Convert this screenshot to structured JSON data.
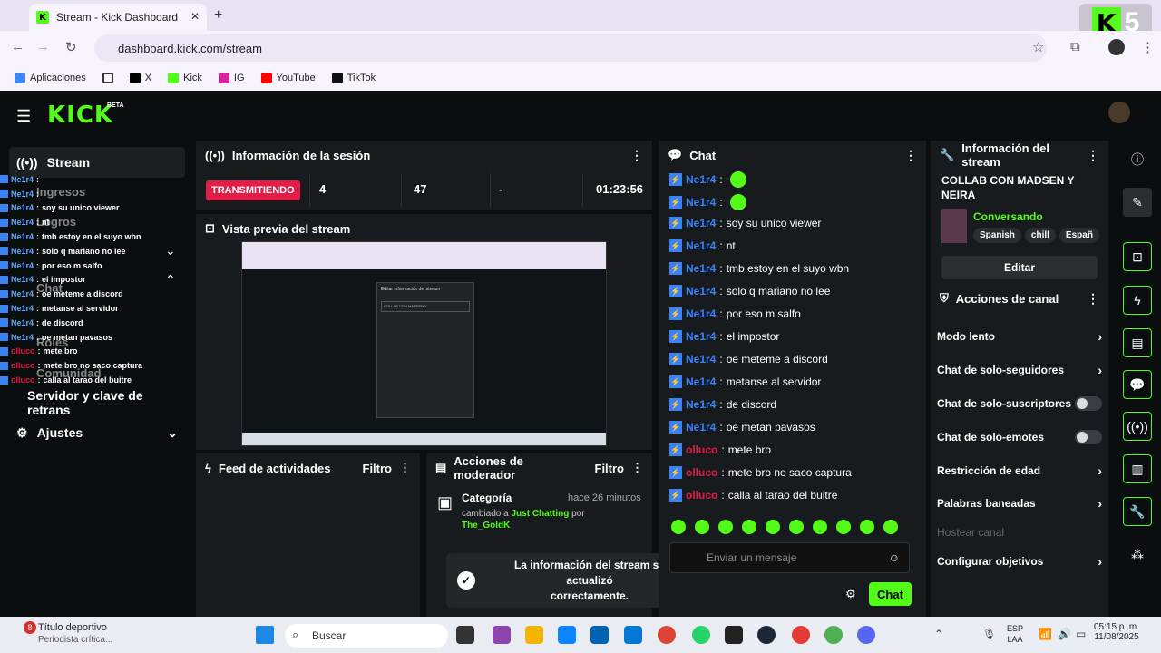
{
  "browser": {
    "tab_title": "Stream - Kick Dashboard",
    "url": "dashboard.kick.com/stream",
    "bookmarks": [
      "Aplicaciones",
      "X",
      "Kick",
      "IG",
      "YouTube",
      "TikTok"
    ],
    "overlay_number": "5"
  },
  "app": {
    "logo": "KICK",
    "beta": "BETA",
    "sidebar": {
      "stream": "Stream",
      "ingresos": "Ingresos",
      "logros": "Logros",
      "chat": "Chat",
      "roles": "Roles",
      "comunidad": "Comunidad",
      "servidor": "Servidor y clave de retrans",
      "ajustes": "Ajustes"
    },
    "sesion": {
      "title": "Información de la sesión",
      "status": "TRANSMITIENDO",
      "viewers": "4",
      "followers": "47",
      "dash": "-",
      "time": "01:23:56"
    },
    "preview": {
      "title": "Vista previa del stream",
      "modal_title": "Editar información del stream",
      "modal_field": "COLLAB CON MADSEN Y"
    },
    "feed": {
      "title": "Feed de actividades",
      "filter": "Filtro"
    },
    "mod": {
      "title": "Acciones de moderador",
      "filter": "Filtro",
      "item_title": "Categoría",
      "item_time": "hace 26 minutos",
      "item_text": "cambiado a",
      "item_cat": "Just Chatting",
      "item_by": "por",
      "item_user": "The_GoldK"
    },
    "toast": {
      "line1": "La información del stream se actualizó",
      "line2": "correctamente."
    },
    "chat": {
      "title": "Chat",
      "placeholder": "Enviar un mensaje",
      "send": "Chat",
      "messages": [
        {
          "user": "Ne1r4",
          "text": ""
        },
        {
          "user": "Ne1r4",
          "text": ""
        },
        {
          "user": "Ne1r4",
          "text": "soy su unico viewer"
        },
        {
          "user": "Ne1r4",
          "text": "nt"
        },
        {
          "user": "Ne1r4",
          "text": "tmb estoy en el suyo wbn"
        },
        {
          "user": "Ne1r4",
          "text": "solo q mariano no lee"
        },
        {
          "user": "Ne1r4",
          "text": "por eso m salfo"
        },
        {
          "user": "Ne1r4",
          "text": "el impostor"
        },
        {
          "user": "Ne1r4",
          "text": "oe meteme a discord"
        },
        {
          "user": "Ne1r4",
          "text": "metanse al servidor"
        },
        {
          "user": "Ne1r4",
          "text": "de discord"
        },
        {
          "user": "Ne1r4",
          "text": "oe metan pavasos"
        },
        {
          "user": "olluco",
          "text": "mete bro"
        },
        {
          "user": "olluco",
          "text": "mete bro no saco captura"
        },
        {
          "user": "olluco",
          "text": "calla al tarao del buitre"
        }
      ]
    },
    "overlay_chat": [
      {
        "user": "Ne1r4",
        "text": ""
      },
      {
        "user": "Ne1r4",
        "text": ""
      },
      {
        "user": "Ne1r4",
        "text": "soy su unico viewer"
      },
      {
        "user": "Ne1r4",
        "text": "nt"
      },
      {
        "user": "Ne1r4",
        "text": "tmb estoy en el suyo wbn"
      },
      {
        "user": "Ne1r4",
        "text": "solo q mariano no lee"
      },
      {
        "user": "Ne1r4",
        "text": "por eso m salfo"
      },
      {
        "user": "Ne1r4",
        "text": "el impostor"
      },
      {
        "user": "Ne1r4",
        "text": "oe meteme a discord"
      },
      {
        "user": "Ne1r4",
        "text": "metanse al servidor"
      },
      {
        "user": "Ne1r4",
        "text": "de discord"
      },
      {
        "user": "Ne1r4",
        "text": "oe metan pavasos"
      },
      {
        "user": "olluco",
        "text": "mete bro"
      },
      {
        "user": "olluco",
        "text": "mete bro no saco captura"
      },
      {
        "user": "olluco",
        "text": "calla al tarao del buitre"
      }
    ],
    "stream_info": {
      "title_header": "Información del stream",
      "stream_title": "COLLAB CON MADSEN Y NEIRA",
      "category": "Conversando",
      "tags": [
        "Spanish",
        "chill",
        "Españ"
      ],
      "edit": "Editar"
    },
    "canal": {
      "title": "Acciones de canal",
      "modo_lento": "Modo lento",
      "seguidores": "Chat de solo-seguidores",
      "suscriptores": "Chat de solo-suscriptores",
      "emotes": "Chat de solo-emotes",
      "edad": "Restricción de edad",
      "baneadas": "Palabras baneadas",
      "hostear": "Hostear canal",
      "objetivos": "Configurar objetivos"
    }
  },
  "taskbar": {
    "news_badge": "8",
    "news_title": "Título deportivo",
    "news_sub": "Periodista crítica...",
    "search": "Buscar",
    "lang1": "ESP",
    "lang2": "LAA",
    "time": "05:15 p. m.",
    "date": "11/08/2025"
  },
  "colors": {
    "kick_green": "#53fc18",
    "live_red": "#e11d48",
    "user_blue": "#3b82f6",
    "user_red": "#e11d48"
  }
}
